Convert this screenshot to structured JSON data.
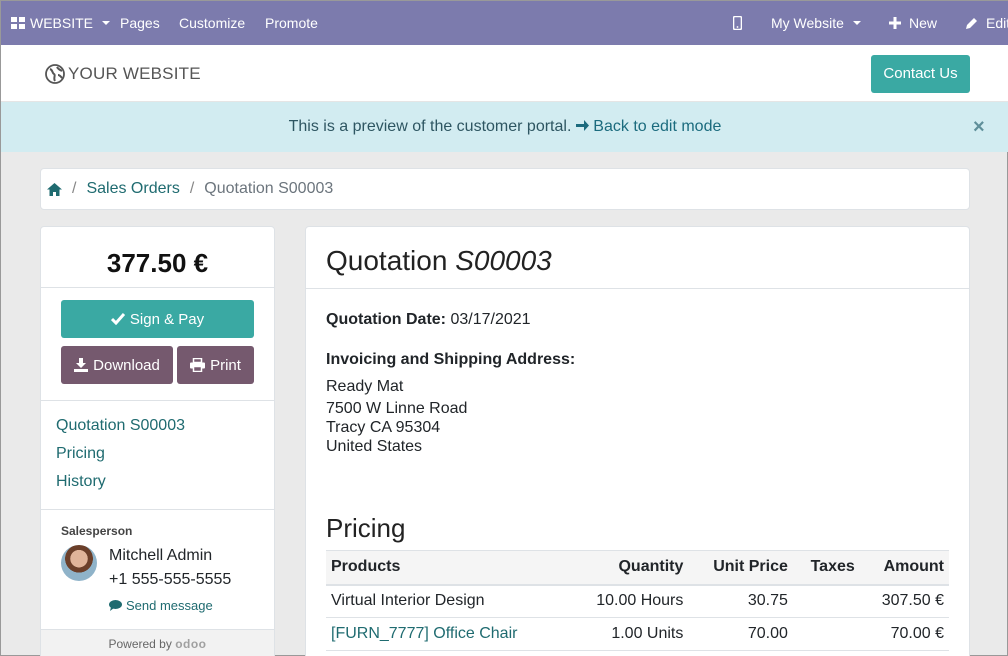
{
  "topbar": {
    "website": "WEBSITE",
    "pages": "Pages",
    "customize": "Customize",
    "promote": "Promote",
    "my_website": "My Website",
    "new": "New",
    "edit": "Edit"
  },
  "header": {
    "logo": "YOUR WEBSITE",
    "contact": "Contact Us"
  },
  "alert": {
    "text": "This is a preview of the customer portal.",
    "link": "Back to edit mode",
    "close": "×"
  },
  "breadcrumb": {
    "sep": "/",
    "sales_orders": "Sales Orders",
    "current": "Quotation S00003"
  },
  "sidebar": {
    "amount": "377.50 €",
    "sign_pay": "Sign & Pay",
    "download": "Download",
    "print": "Print",
    "nav": [
      "Quotation S00003",
      "Pricing",
      "History"
    ],
    "salesperson_label": "Salesperson",
    "salesperson_name": "Mitchell Admin",
    "salesperson_phone": "+1 555-555-5555",
    "send_message": "Send message",
    "powered_by": "Powered by",
    "odoo": "odoo"
  },
  "quote": {
    "title_prefix": "Quotation",
    "number": "S00003",
    "date_label": "Quotation Date:",
    "date": "03/17/2021",
    "address_label": "Invoicing and Shipping Address:",
    "address": [
      "Ready Mat",
      "7500 W Linne Road",
      "Tracy CA 95304",
      "United States"
    ]
  },
  "pricing": {
    "title": "Pricing",
    "headers": [
      "Products",
      "Quantity",
      "Unit Price",
      "Taxes",
      "Amount"
    ],
    "rows": [
      [
        "Virtual Interior Design",
        "10.00 Hours",
        "30.75",
        "",
        "307.50 €"
      ],
      [
        "[FURN_7777] Office Chair",
        "1.00 Units",
        "70.00",
        "",
        "70.00 €"
      ]
    ]
  }
}
